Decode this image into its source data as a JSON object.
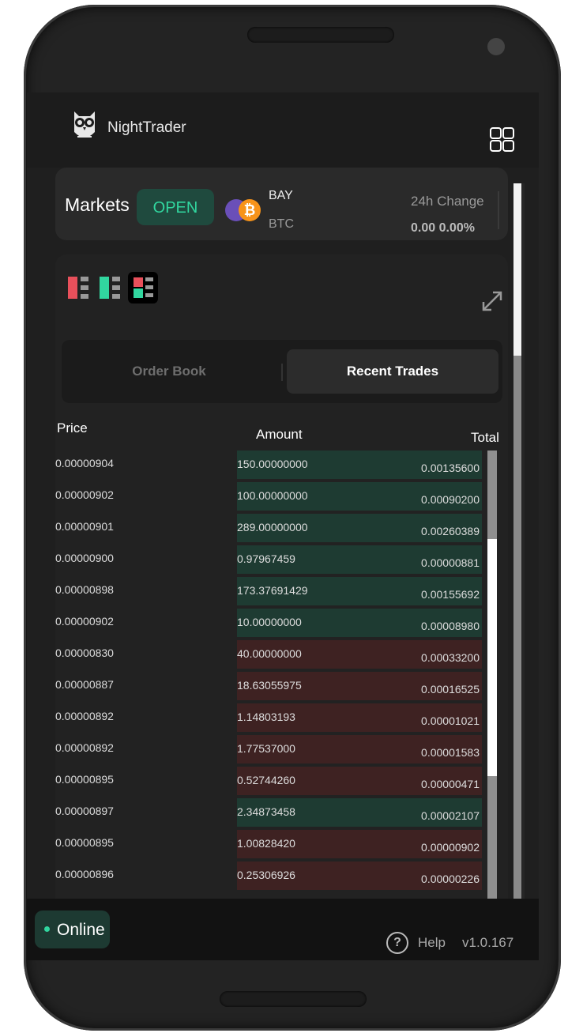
{
  "app": {
    "name": "NightTrader"
  },
  "markets": {
    "title": "Markets",
    "status_button": "OPEN",
    "pair_base": "BAY",
    "pair_quote": "BTC",
    "change_label": "24h Change",
    "change_value": "0.00 0.00%"
  },
  "tabs": {
    "order_book": "Order Book",
    "recent_trades": "Recent Trades",
    "active": "recent_trades"
  },
  "columns": {
    "price": "Price",
    "amount": "Amount",
    "total": "Total"
  },
  "trades": [
    {
      "price": "0.00000904",
      "amount": "150.00000000",
      "total": "0.00135600",
      "side": "buy"
    },
    {
      "price": "0.00000902",
      "amount": "100.00000000",
      "total": "0.00090200",
      "side": "buy"
    },
    {
      "price": "0.00000901",
      "amount": "289.00000000",
      "total": "0.00260389",
      "side": "buy"
    },
    {
      "price": "0.00000900",
      "amount": "0.97967459",
      "total": "0.00000881",
      "side": "buy"
    },
    {
      "price": "0.00000898",
      "amount": "173.37691429",
      "total": "0.00155692",
      "side": "buy"
    },
    {
      "price": "0.00000902",
      "amount": "10.00000000",
      "total": "0.00008980",
      "side": "buy"
    },
    {
      "price": "0.00000830",
      "amount": "40.00000000",
      "total": "0.00033200",
      "side": "sell"
    },
    {
      "price": "0.00000887",
      "amount": "18.63055975",
      "total": "0.00016525",
      "side": "sell"
    },
    {
      "price": "0.00000892",
      "amount": "1.14803193",
      "total": "0.00001021",
      "side": "sell"
    },
    {
      "price": "0.00000892",
      "amount": "1.77537000",
      "total": "0.00001583",
      "side": "sell"
    },
    {
      "price": "0.00000895",
      "amount": "0.52744260",
      "total": "0.00000471",
      "side": "sell"
    },
    {
      "price": "0.00000897",
      "amount": "2.34873458",
      "total": "0.00002107",
      "side": "buy"
    },
    {
      "price": "0.00000895",
      "amount": "1.00828420",
      "total": "0.00000902",
      "side": "sell"
    },
    {
      "price": "0.00000896",
      "amount": "0.25306926",
      "total": "0.00000226",
      "side": "sell"
    }
  ],
  "footer": {
    "status": "Online",
    "help": "Help",
    "version": "v1.0.167"
  },
  "colors": {
    "buy": "#1e3b32",
    "sell": "#3e2222",
    "accent": "#31d69f",
    "bitcoin": "#f7931a"
  },
  "icons": [
    "owl-logo-icon",
    "grid-menu-icon",
    "bitcoin-icon",
    "view-sell-icon",
    "view-buy-icon",
    "view-both-icon",
    "expand-icon",
    "help-icon"
  ]
}
